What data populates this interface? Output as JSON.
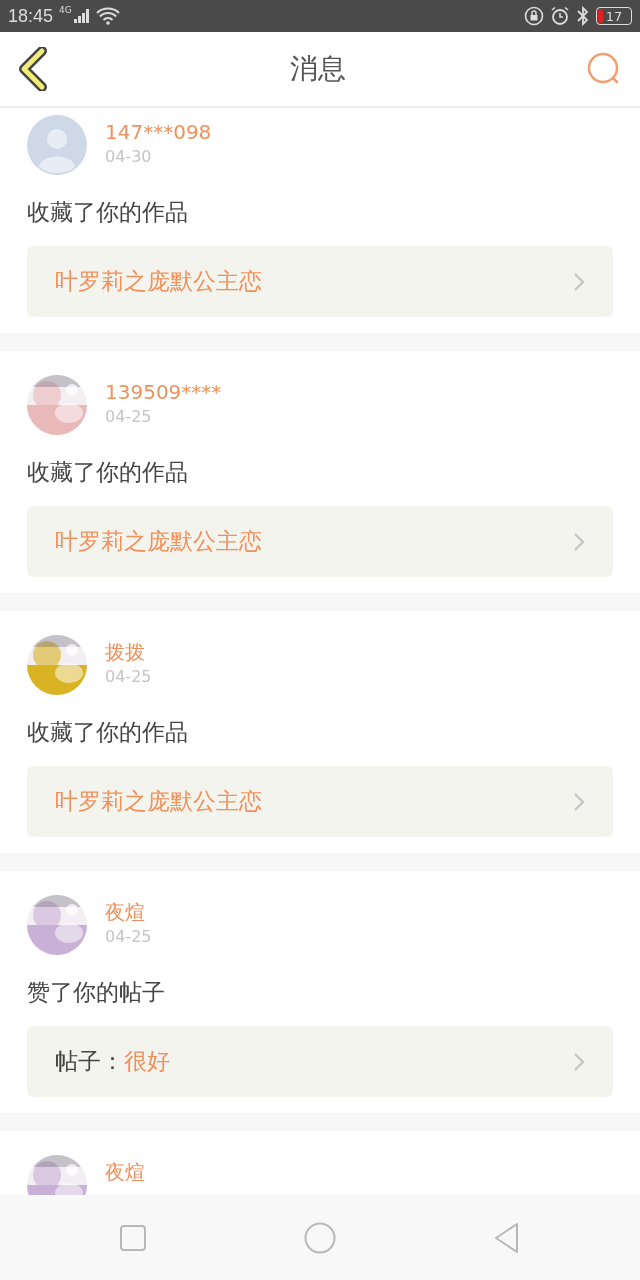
{
  "status_bar": {
    "time": "18:45",
    "network": "4G",
    "battery": "17"
  },
  "header": {
    "title": "消息"
  },
  "messages": [
    {
      "avatar": {
        "kind": "default"
      },
      "name": "147***098",
      "date": "04-30",
      "action": "收藏了你的作品",
      "target": {
        "kind": "work",
        "title": "叶罗莉之庞默公主恋"
      }
    },
    {
      "name": "139509****",
      "date": "04-25",
      "action": "收藏了你的作品",
      "target": {
        "kind": "work",
        "title": "叶罗莉之庞默公主恋"
      }
    },
    {
      "name": "拨拨",
      "date": "04-25",
      "action": "收藏了你的作品",
      "target": {
        "kind": "work",
        "title": "叶罗莉之庞默公主恋"
      }
    },
    {
      "name": "夜煊",
      "date": "04-25",
      "action": "赞了你的帖子",
      "target": {
        "kind": "post",
        "label": "帖子：",
        "title": "很好"
      }
    },
    {
      "name": "夜煊"
    }
  ]
}
